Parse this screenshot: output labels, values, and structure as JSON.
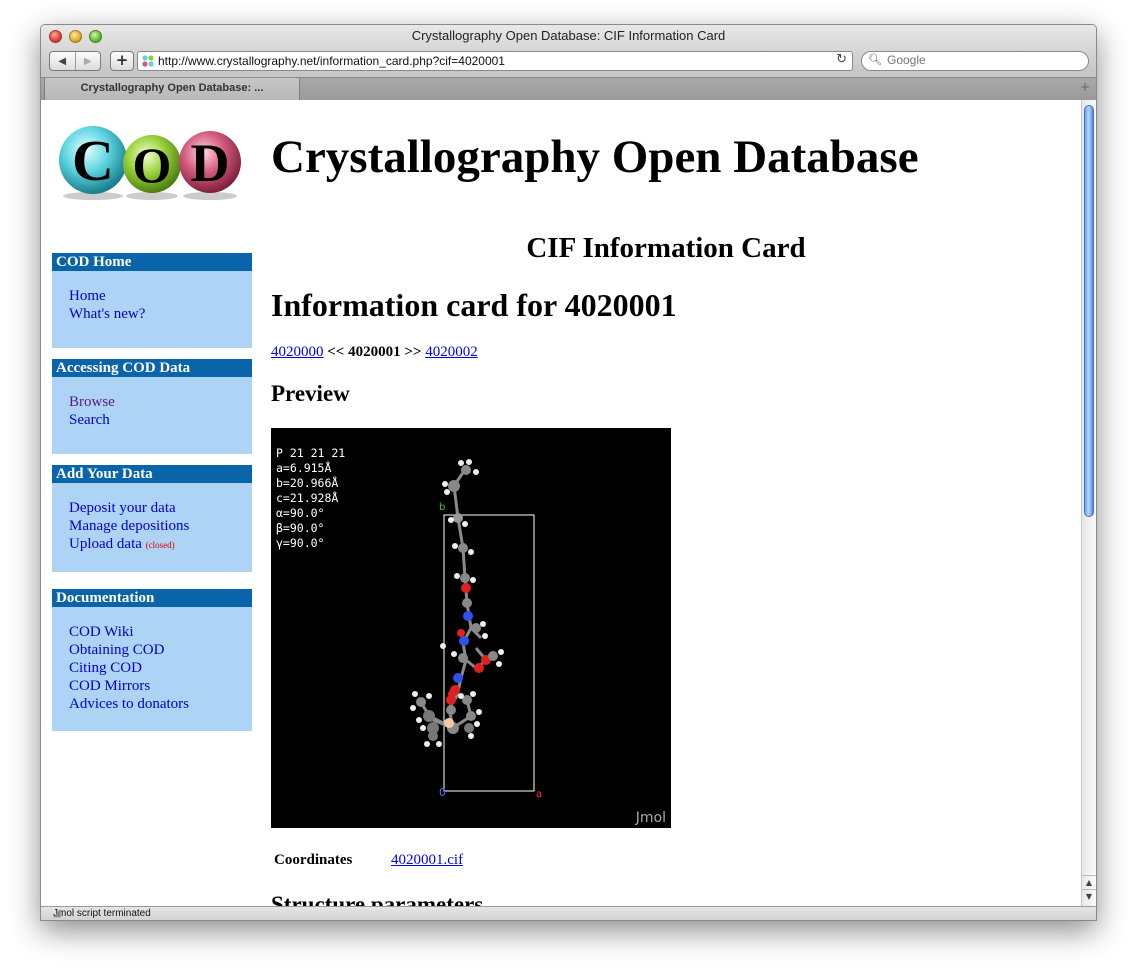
{
  "window": {
    "title": "Crystallography Open Database: CIF Information Card"
  },
  "toolbar": {
    "back_icon": "back-arrow-icon",
    "forward_icon": "forward-arrow-icon",
    "add_label": "+",
    "url": "http://www.crystallography.net/information_card.php?cif=4020001",
    "reload_icon": "reload-icon",
    "search_placeholder": "Google"
  },
  "tabs": [
    {
      "label": "Crystallography Open Database: ..."
    }
  ],
  "header": {
    "logo_text": "COD",
    "site_title": "Crystallography Open Database"
  },
  "sidebar": {
    "sections": [
      {
        "title": "COD Home",
        "items": [
          {
            "label": "Home"
          },
          {
            "label": "What's new?"
          }
        ]
      },
      {
        "title": "Accessing COD Data",
        "items": [
          {
            "label": "Browse"
          },
          {
            "label": "Search"
          }
        ]
      },
      {
        "title": "Add Your Data",
        "items": [
          {
            "label": "Deposit your data"
          },
          {
            "label": "Manage depositions"
          },
          {
            "label": "Upload data",
            "note": "(closed)"
          }
        ]
      },
      {
        "title": "Documentation",
        "items": [
          {
            "label": "COD Wiki"
          },
          {
            "label": "Obtaining COD"
          },
          {
            "label": "Citing COD"
          },
          {
            "label": "COD Mirrors"
          },
          {
            "label": "Advices to donators"
          }
        ]
      }
    ]
  },
  "main": {
    "card_title": "CIF Information Card",
    "heading": "Information card for 4020001",
    "nav": {
      "prev": "4020000",
      "prev_sep": "<<",
      "current": "4020001",
      "next_sep": ">>",
      "next": "4020002"
    },
    "preview_heading": "Preview",
    "viewer": {
      "info_lines": [
        "P 21 21 21",
        "a=6.915Å",
        "b=20.966Å",
        "c=21.928Å",
        "α=90.0°",
        "β=90.0°",
        "γ=90.0°"
      ],
      "brand": "Jmol",
      "axis_b": "b",
      "axis_o": "0",
      "axis_a": "a"
    },
    "coordinates_label": "Coordinates",
    "coordinates_link": "4020001.cif",
    "next_heading": "Structure parameters"
  },
  "status": {
    "text": "Jmol script terminated"
  }
}
